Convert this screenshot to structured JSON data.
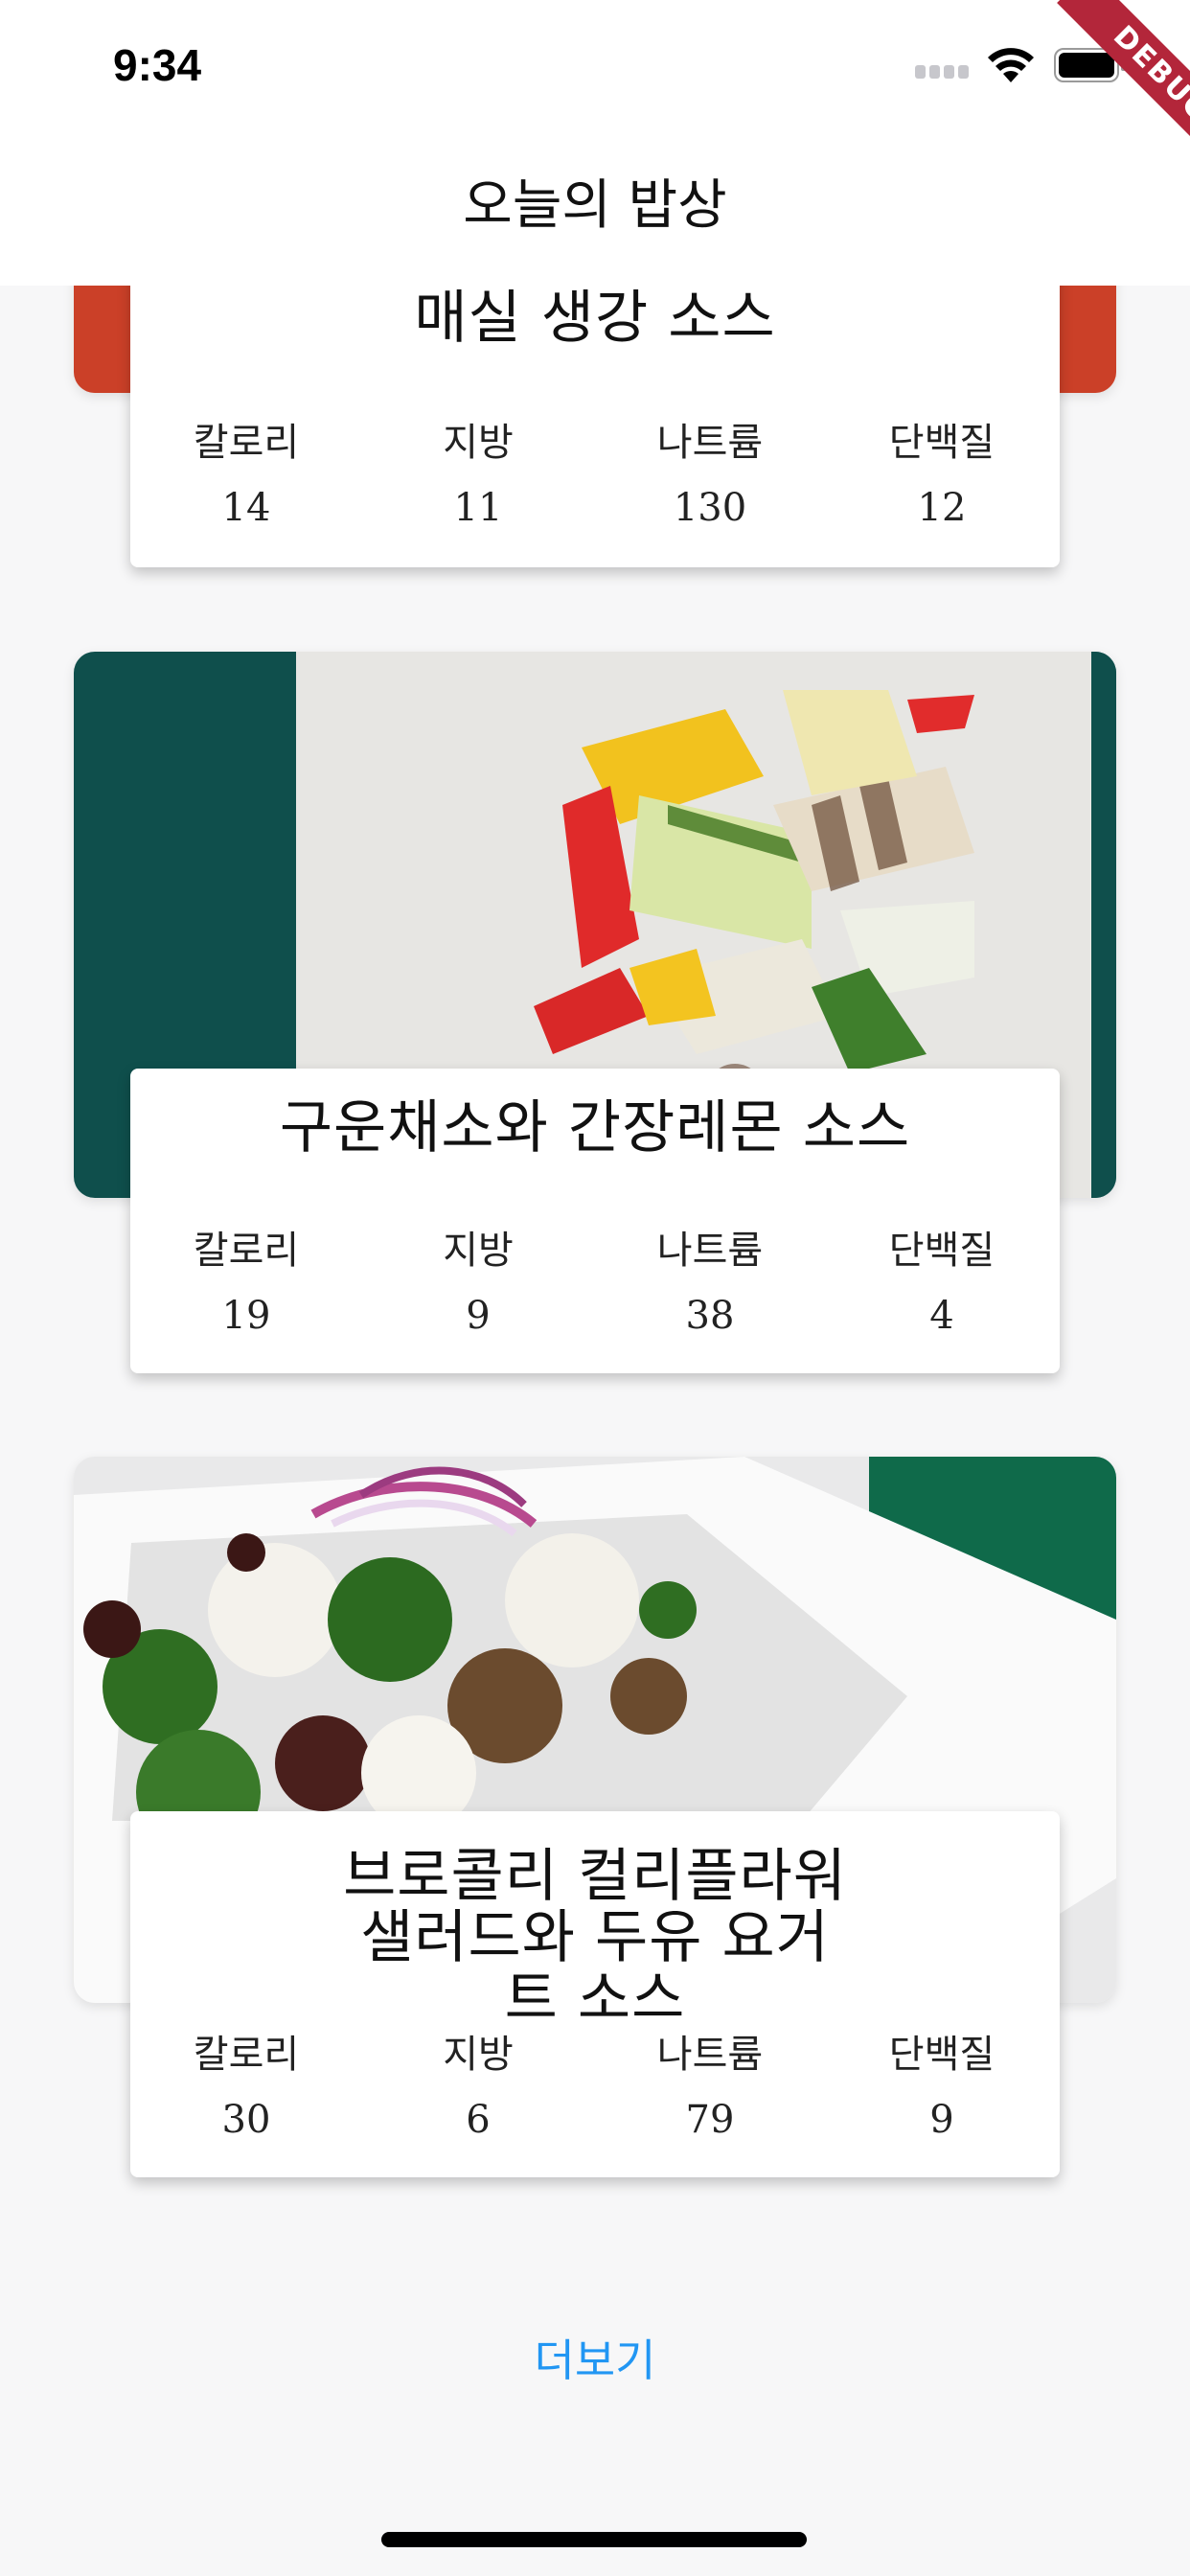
{
  "status_bar": {
    "time": "9:34",
    "icons": [
      "signal-icon",
      "wifi-icon",
      "battery-icon"
    ]
  },
  "debug_banner": "DEBUG",
  "app_bar": {
    "title": "오늘의 밥상"
  },
  "nutrient_labels": {
    "calories": "칼로리",
    "fat": "지방",
    "sodium": "나트륨",
    "protein": "단백질"
  },
  "recipes": [
    {
      "title": "매실 생강 소스",
      "calories": "14",
      "fat": "11",
      "sodium": "130",
      "protein": "12"
    },
    {
      "title": "구운채소와 간장레몬 소스",
      "calories": "19",
      "fat": "9",
      "sodium": "38",
      "protein": "4"
    },
    {
      "title": "브로콜리 컬리플라워 샐러드와 두유 요거트 소스",
      "calories": "30",
      "fat": "6",
      "sodium": "79",
      "protein": "9"
    }
  ],
  "more_button": "더보기",
  "colors": {
    "accent": "#2196f3",
    "background": "#f7f7f8",
    "debug_banner": "#b3263a"
  }
}
